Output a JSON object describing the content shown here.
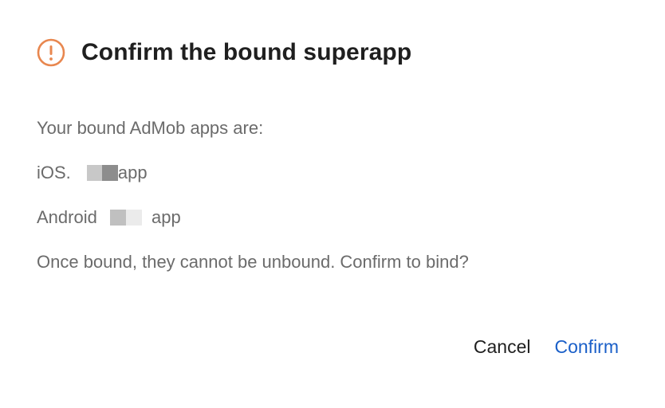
{
  "dialog": {
    "title": "Confirm the bound superapp",
    "icon": "warning-circle-icon",
    "accent_color": "#e8874f",
    "intro": "Your bound AdMob apps are:",
    "ios_prefix": "iOS.",
    "ios_suffix": "app",
    "android_prefix": "Android",
    "android_suffix": "app",
    "warning": "Once bound, they cannot be unbound. Confirm to bind?",
    "cancel_label": "Cancel",
    "confirm_label": "Confirm",
    "link_color": "#1a5fc8"
  }
}
